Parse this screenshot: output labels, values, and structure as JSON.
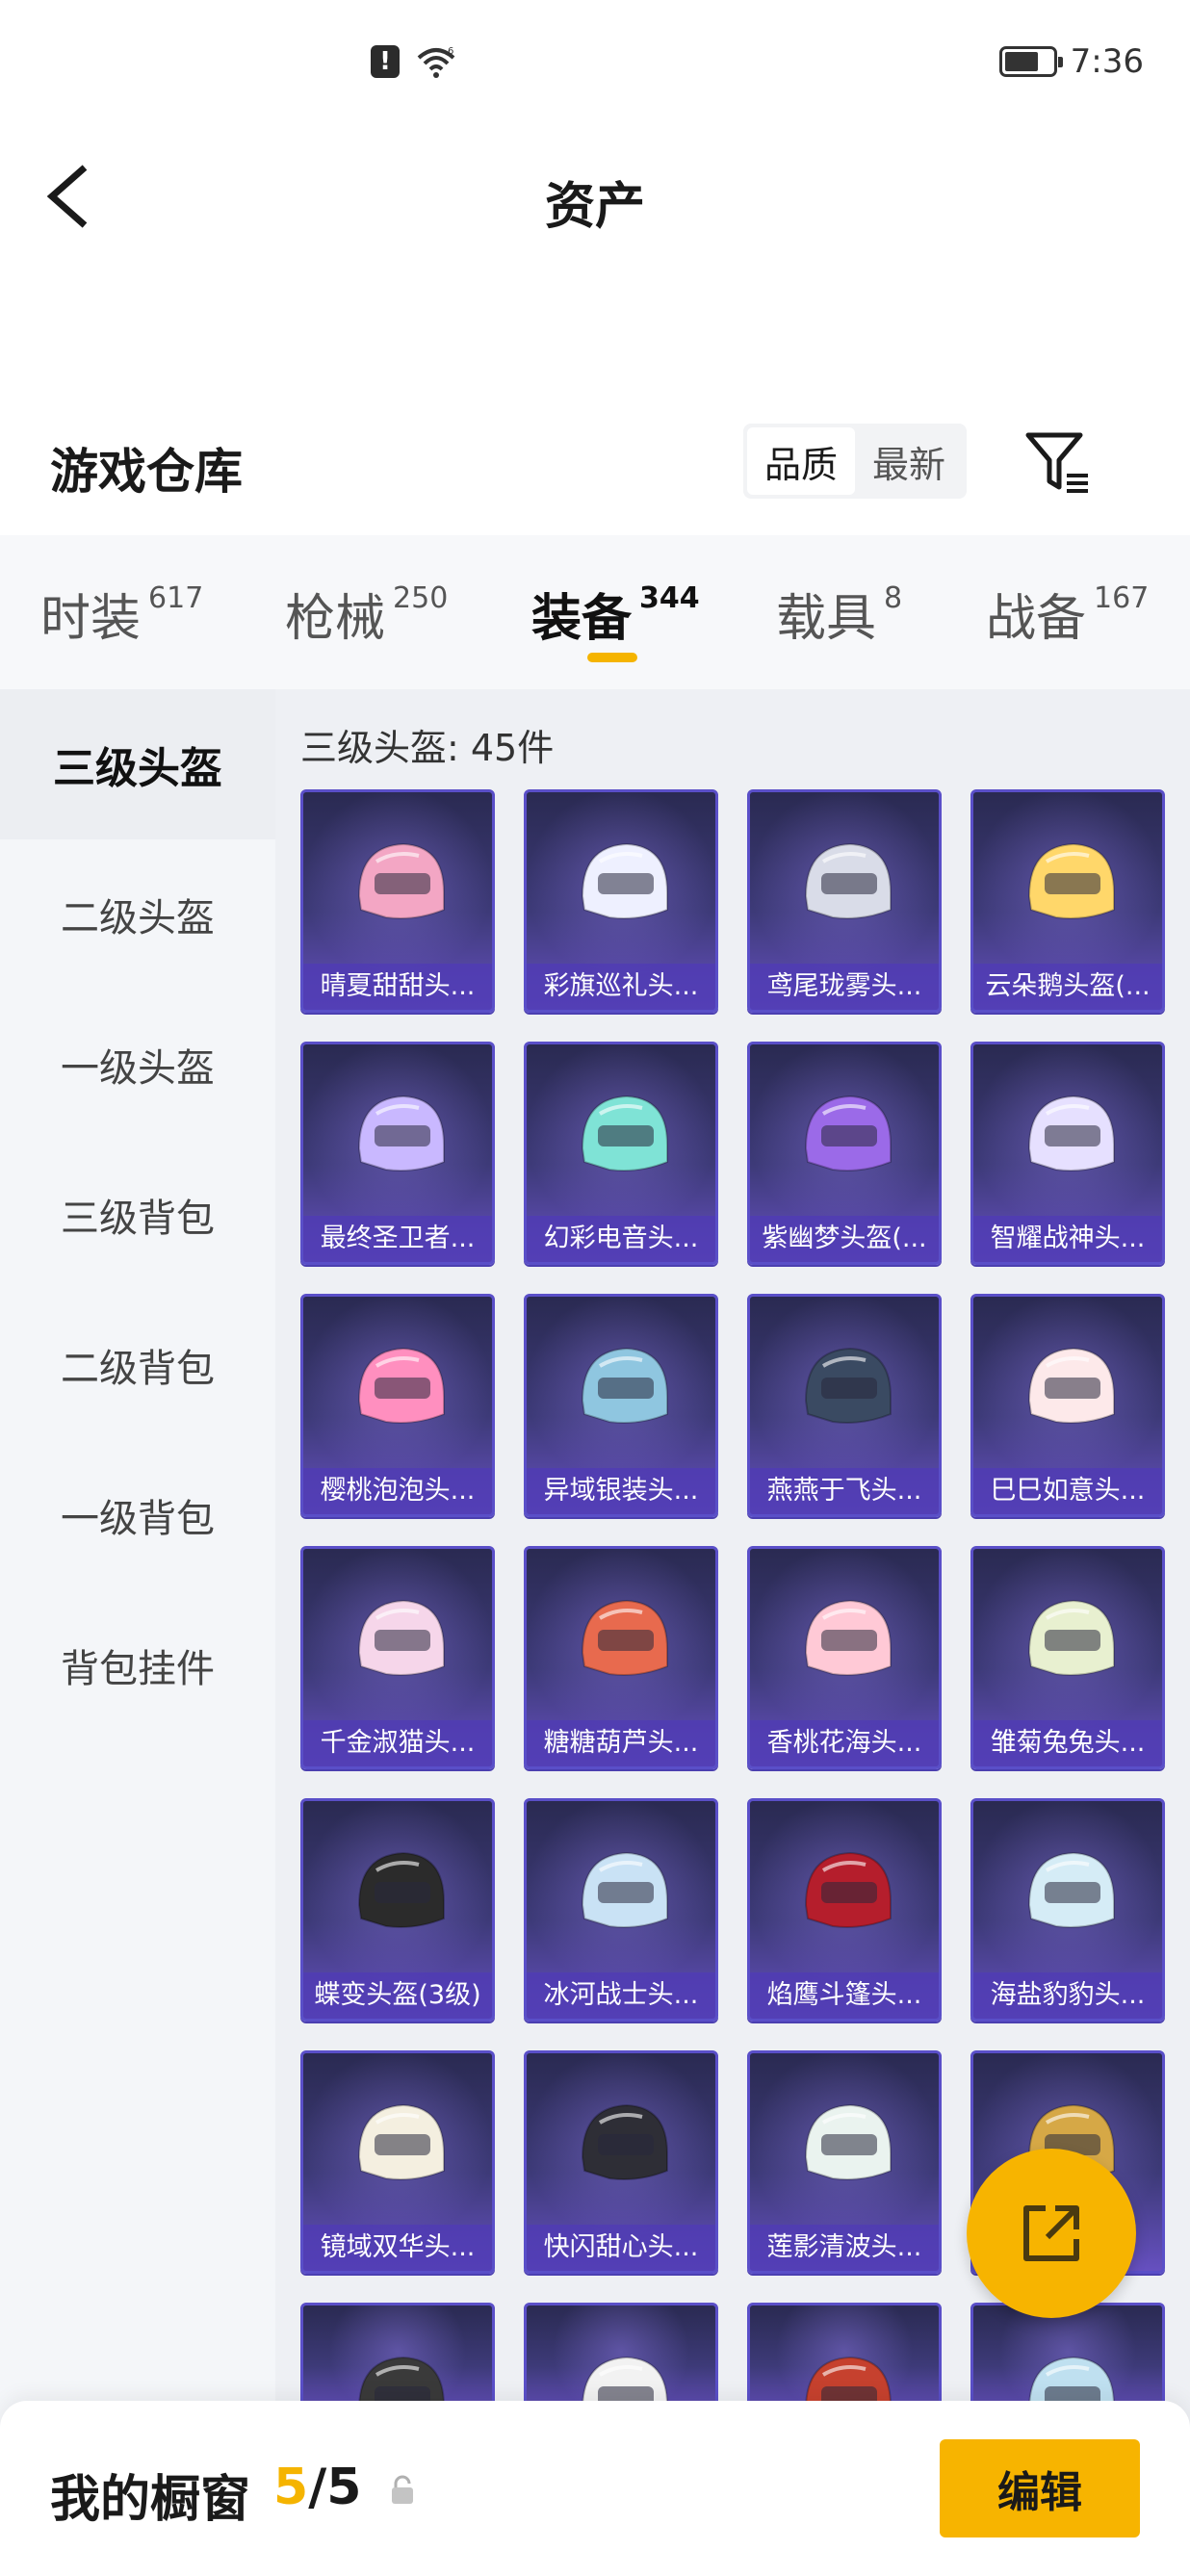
{
  "status_bar": {
    "time": "7:36",
    "alert": "!",
    "signal": "6",
    "battery_level": 0.7
  },
  "header": {
    "title": "资产"
  },
  "section": {
    "title": "游戏仓库",
    "sort_options": [
      "品质",
      "最新"
    ],
    "sort_active": "品质"
  },
  "tabs": [
    {
      "label": "时装",
      "count": "617"
    },
    {
      "label": "枪械",
      "count": "250"
    },
    {
      "label": "装备",
      "count": "344",
      "active": true
    },
    {
      "label": "载具",
      "count": "8"
    },
    {
      "label": "战备",
      "count": "167"
    }
  ],
  "sidebar": {
    "items": [
      {
        "label": "三级头盔",
        "active": true
      },
      {
        "label": "二级头盔"
      },
      {
        "label": "一级头盔"
      },
      {
        "label": "三级背包"
      },
      {
        "label": "二级背包"
      },
      {
        "label": "一级背包"
      },
      {
        "label": "背包挂件"
      }
    ]
  },
  "grid": {
    "count_text": "三级头盔: 45件",
    "items": [
      {
        "name": "晴夏甜甜头...",
        "color": "#f3a6c4"
      },
      {
        "name": "彩旗巡礼头...",
        "color": "#eef0ff"
      },
      {
        "name": "鸢尾珑雾头...",
        "color": "#d9dce8"
      },
      {
        "name": "云朵鹅头盔(...",
        "color": "#ffd76a"
      },
      {
        "name": "最终圣卫者...",
        "color": "#c9b8ff"
      },
      {
        "name": "幻彩电音头...",
        "color": "#7fe3d6"
      },
      {
        "name": "紫幽梦头盔(...",
        "color": "#9b6ae8"
      },
      {
        "name": "智耀战神头...",
        "color": "#e6e0ff"
      },
      {
        "name": "樱桃泡泡头...",
        "color": "#ff8fbf"
      },
      {
        "name": "异域银装头...",
        "color": "#8fc6e0"
      },
      {
        "name": "燕燕于飞头...",
        "color": "#3a4a62"
      },
      {
        "name": "巳巳如意头...",
        "color": "#fde9ea"
      },
      {
        "name": "千金淑猫头...",
        "color": "#f6d6ea"
      },
      {
        "name": "糖糖葫芦头...",
        "color": "#e86a4e"
      },
      {
        "name": "香桃花海头...",
        "color": "#ffc9d6"
      },
      {
        "name": "雏菊兔兔头...",
        "color": "#e8f0d0"
      },
      {
        "name": "蝶变头盔(3级)",
        "color": "#2b2b2b"
      },
      {
        "name": "冰河战士头...",
        "color": "#c9e2f5"
      },
      {
        "name": "焰鹰斗篷头...",
        "color": "#b51e2c"
      },
      {
        "name": "海盐豹豹头...",
        "color": "#d5ecf6"
      },
      {
        "name": "镜域双华头...",
        "color": "#f4efe0"
      },
      {
        "name": "快闪甜心头...",
        "color": "#2e2e36"
      },
      {
        "name": "莲影清波头...",
        "color": "#eaf3ef"
      },
      {
        "name": "",
        "color": "#d6a846"
      },
      {
        "name": "",
        "color": "#3a3a3a"
      },
      {
        "name": "",
        "color": "#f2f2f2"
      },
      {
        "name": "",
        "color": "#c6412e"
      },
      {
        "name": "",
        "color": "#bfe0f0"
      }
    ]
  },
  "bottom": {
    "showcase_label": "我的橱窗",
    "showcase_current": "5",
    "showcase_sep": "/",
    "showcase_total": "5",
    "edit_label": "编辑"
  }
}
